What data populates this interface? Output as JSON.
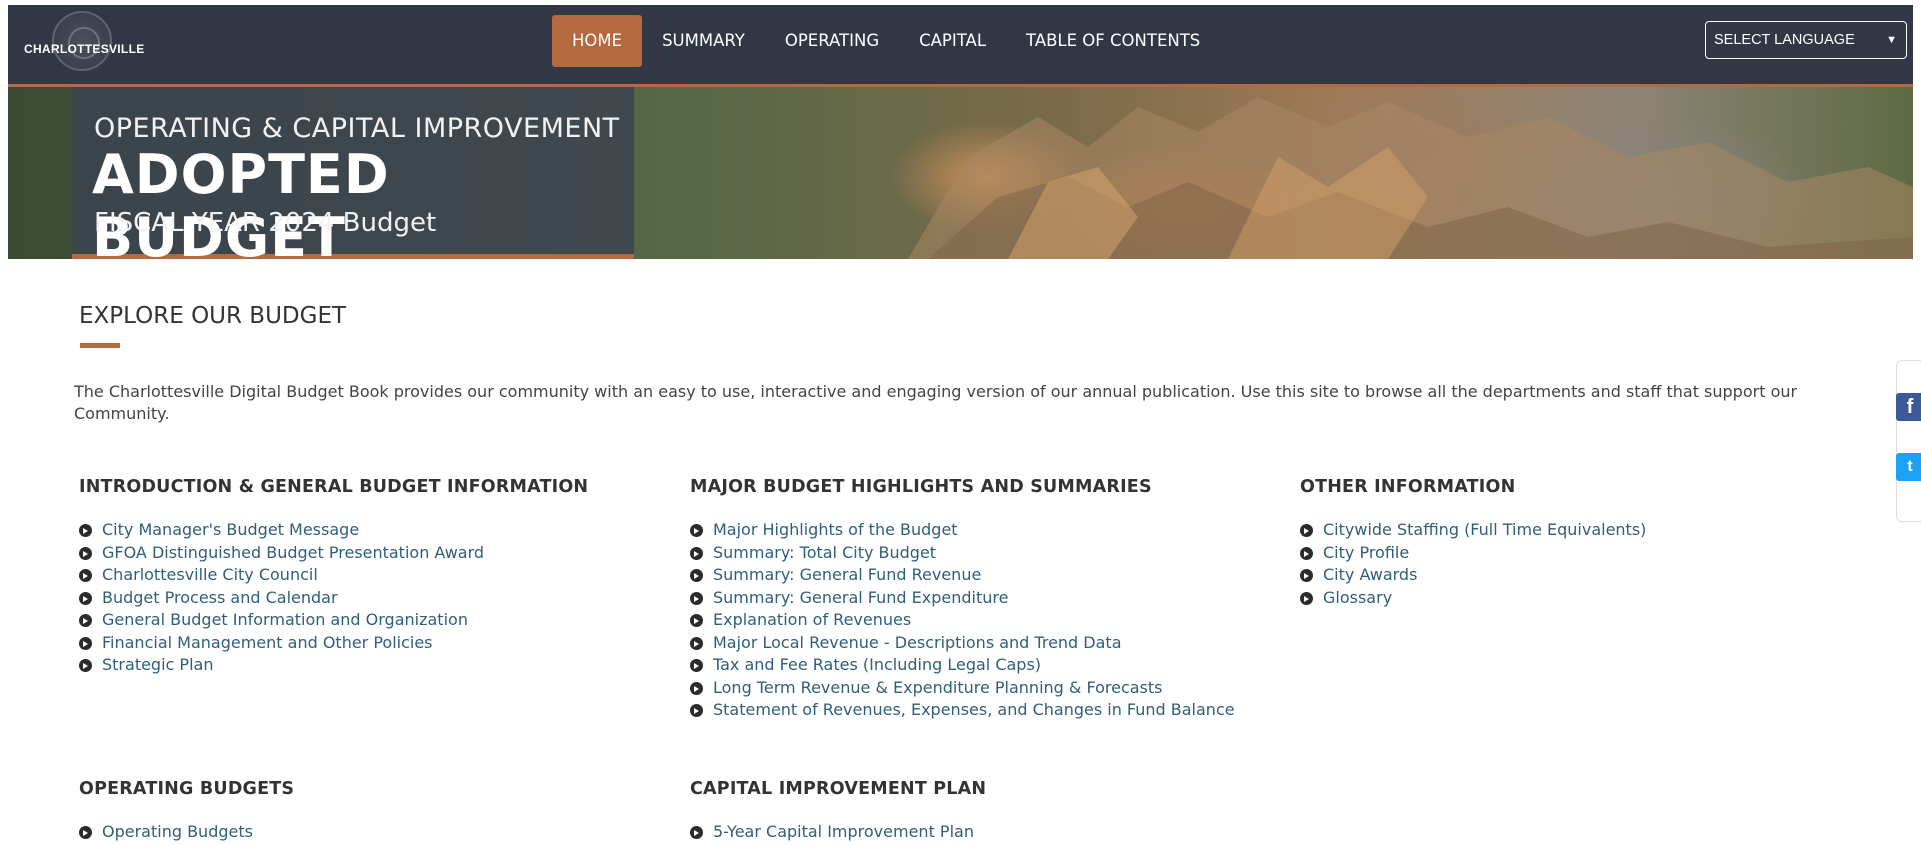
{
  "header": {
    "logo_text": "CHARLOTTESVILLE",
    "nav": [
      {
        "label": "HOME",
        "active": true
      },
      {
        "label": "SUMMARY"
      },
      {
        "label": "OPERATING"
      },
      {
        "label": "CAPITAL"
      },
      {
        "label": "TABLE OF CONTENTS"
      }
    ],
    "language_select": "SELECT LANGUAGE"
  },
  "hero": {
    "line1": "OPERATING & CAPITAL IMPROVEMENT",
    "line2": "ADOPTED BUDGET",
    "line3": "FISCAL YEAR 2024 Budget"
  },
  "explore": {
    "title": "EXPLORE OUR BUDGET",
    "intro": "The Charlottesville Digital Budget Book provides our community with an easy to use, interactive and engaging version of our annual publication. Use this site to browse all the departments and staff that support our Community."
  },
  "sections": [
    {
      "heading": "INTRODUCTION & GENERAL BUDGET INFORMATION",
      "links": [
        "City Manager's Budget Message",
        "GFOA Distinguished Budget Presentation Award",
        "Charlottesville City Council",
        "Budget Process and Calendar",
        "General Budget Information and Organization",
        "Financial Management and Other Policies",
        "Strategic Plan"
      ]
    },
    {
      "heading": "MAJOR BUDGET HIGHLIGHTS AND SUMMARIES",
      "links": [
        "Major Highlights of the Budget",
        "Summary: Total City Budget",
        "Summary: General Fund Revenue",
        "Summary: General Fund Expenditure",
        "Explanation of Revenues",
        "Major Local Revenue - Descriptions and Trend Data",
        "Tax and Fee Rates (Including Legal Caps)",
        "Long Term Revenue & Expenditure Planning & Forecasts",
        "Statement of Revenues, Expenses, and Changes in Fund Balance"
      ]
    },
    {
      "heading": "OTHER INFORMATION",
      "links": [
        "Citywide Staffing (Full Time Equivalents)",
        "City Profile",
        "City Awards",
        "Glossary"
      ]
    },
    {
      "heading": "OPERATING BUDGETS",
      "links": [
        "Operating Budgets"
      ]
    },
    {
      "heading": "CAPITAL IMPROVEMENT PLAN",
      "links": [
        "5-Year Capital Improvement Plan"
      ]
    }
  ],
  "social": {
    "facebook_icon": "f",
    "twitter_icon": "t"
  }
}
